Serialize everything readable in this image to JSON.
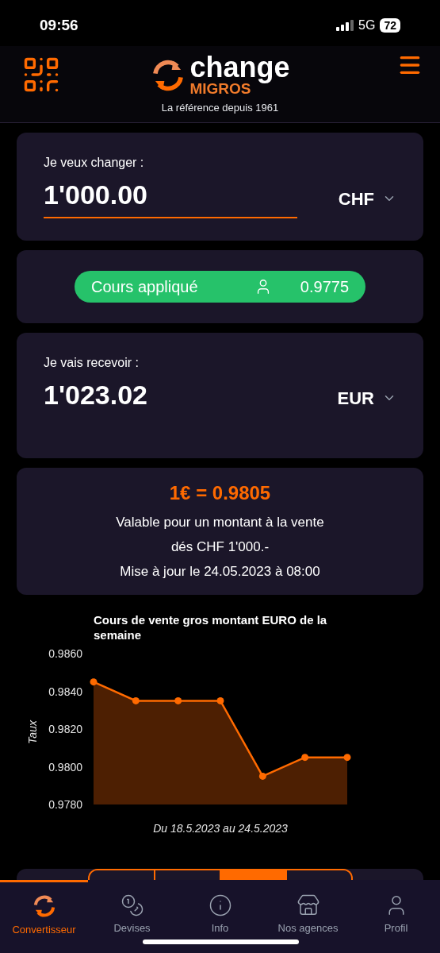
{
  "status_bar": {
    "time": "09:56",
    "network": "5G",
    "battery": "72"
  },
  "header": {
    "logo_word": "change",
    "logo_sub": "MIGROS",
    "tagline": "La référence depuis 1961"
  },
  "from": {
    "label": "Je veux changer :",
    "value": "1'000.00",
    "currency": "CHF"
  },
  "rate_pill": {
    "label": "Cours appliqué",
    "value": "0.9775"
  },
  "to": {
    "label": "Je vais recevoir :",
    "value": "1'023.02",
    "currency": "EUR"
  },
  "offer": {
    "headline": "1€ = 0.9805",
    "lines": [
      "Valable pour un montant à la vente",
      "dés CHF 1'000.-",
      "Mise à jour le 24.05.2023 à 08:00"
    ]
  },
  "chart": {
    "chart_data": {
      "type": "area",
      "title": "Cours de vente gros montant EURO de la semaine",
      "xlabel": "Du 18.5.2023 au 24.5.2023",
      "ylabel": "Taux",
      "series": [
        {
          "color": "#ff6a00",
          "values": [
            0.9845,
            0.9835,
            0.9835,
            0.9835,
            0.9795,
            0.9805,
            0.9805
          ]
        }
      ],
      "ylim": [
        0.978,
        0.986
      ],
      "yticks": [
        {
          "value": 0.978,
          "label": "0.9780"
        },
        {
          "value": 0.98,
          "label": "0.9800"
        },
        {
          "value": 0.982,
          "label": "0.9820"
        },
        {
          "value": 0.984,
          "label": "0.9840"
        },
        {
          "value": 0.986,
          "label": "0.9860"
        }
      ]
    }
  },
  "segments": [
    {
      "selected": false
    },
    {
      "selected": false
    },
    {
      "selected": true
    },
    {
      "selected": false
    }
  ],
  "tab_bar": [
    {
      "kind": "convert",
      "label": "Convertisseur",
      "selected": true
    },
    {
      "kind": "currencies",
      "label": "Devises",
      "selected": false
    },
    {
      "kind": "info",
      "label": "Info",
      "selected": false
    },
    {
      "kind": "agencies",
      "label": "Nos agences",
      "selected": false
    },
    {
      "kind": "profile",
      "label": "Profil",
      "selected": false
    }
  ]
}
